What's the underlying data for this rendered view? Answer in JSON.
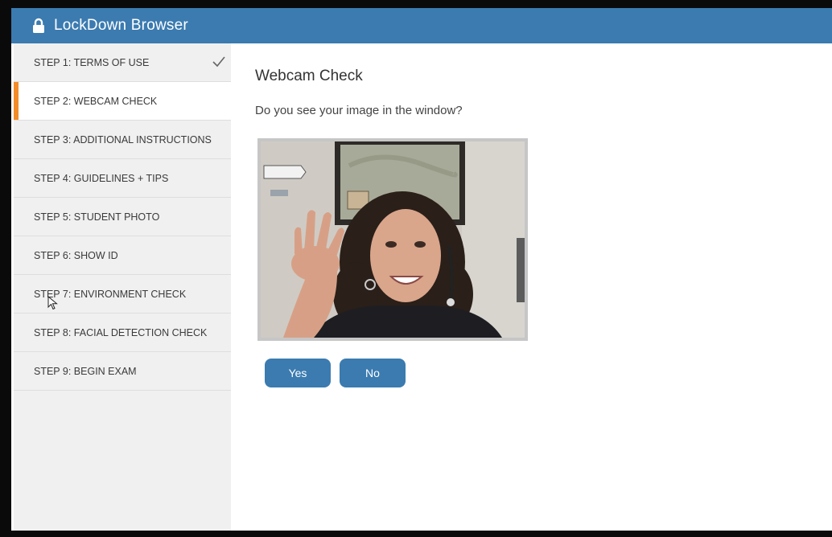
{
  "app": {
    "title": "LockDown Browser",
    "icon": "lock-icon"
  },
  "sidebar": {
    "active_index": 1,
    "steps": [
      {
        "label": "STEP 1: TERMS OF USE",
        "completed": true
      },
      {
        "label": "STEP 2: WEBCAM CHECK",
        "completed": false
      },
      {
        "label": "STEP 3: ADDITIONAL INSTRUCTIONS",
        "completed": false
      },
      {
        "label": "STEP 4: GUIDELINES + TIPS",
        "completed": false
      },
      {
        "label": "STEP 5: STUDENT PHOTO",
        "completed": false
      },
      {
        "label": "STEP 6: SHOW ID",
        "completed": false
      },
      {
        "label": "STEP 7: ENVIRONMENT CHECK",
        "completed": false
      },
      {
        "label": "STEP 8: FACIAL DETECTION CHECK",
        "completed": false
      },
      {
        "label": "STEP 9: BEGIN EXAM",
        "completed": false
      }
    ]
  },
  "main": {
    "heading": "Webcam Check",
    "question": "Do you see your image in the window?",
    "yes_label": "Yes",
    "no_label": "No"
  },
  "colors": {
    "accent": "#3b7bb0",
    "active_marker": "#f28c28",
    "sidebar_bg": "#f0f0f0"
  }
}
